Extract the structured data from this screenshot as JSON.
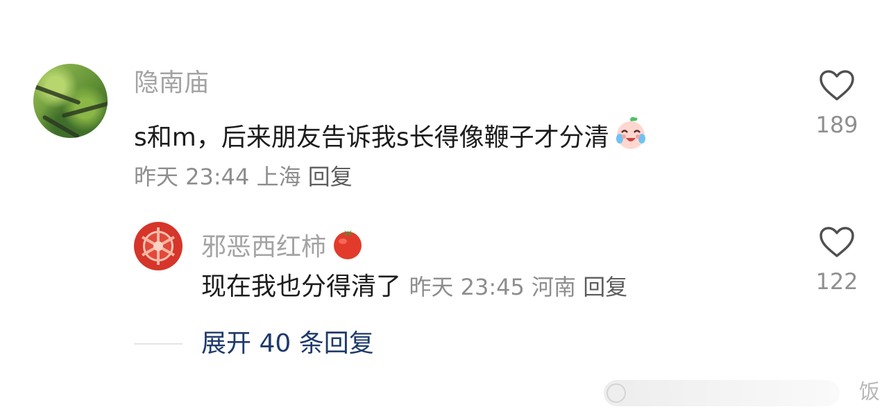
{
  "comment": {
    "username": "隐南庙",
    "content": "s和m，后来朋友告诉我s长得像鞭子才分清",
    "content_emoji": "crying-laughing-baby-emoji",
    "time": "昨天 23:44",
    "location": "上海",
    "reply_label": "回复",
    "likes": "189"
  },
  "reply": {
    "username": "邪恶西红柿",
    "username_emoji": "tomato-emoji",
    "content": "现在我也分得清了",
    "time": "昨天 23:45",
    "location": "河南",
    "reply_label": "回复",
    "likes": "122"
  },
  "expand_label": "展开 40 条回复",
  "watermark_text": "饭",
  "colors": {
    "username": "#a3a3a3",
    "content": "#1c1c1c",
    "meta": "#8d8d8d",
    "expand": "#1f3a6b"
  }
}
